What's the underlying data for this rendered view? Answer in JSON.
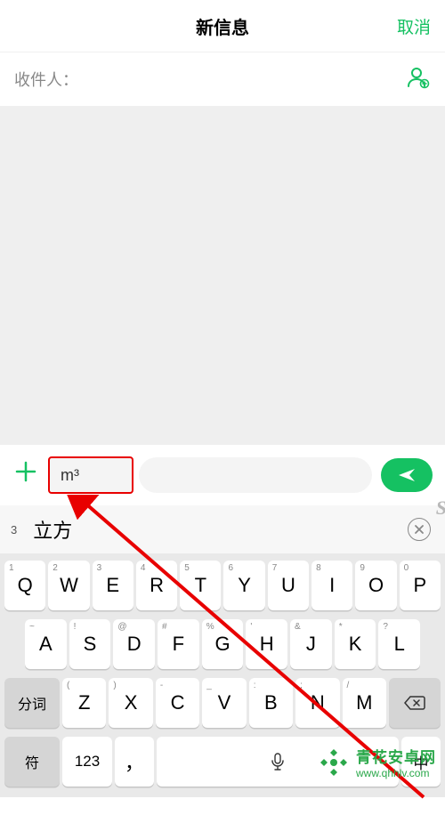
{
  "header": {
    "title": "新信息",
    "cancel": "取消"
  },
  "recipient": {
    "label": "收件人："
  },
  "input": {
    "value": "m³"
  },
  "candidates": {
    "small": "3",
    "main": "立方",
    "s_hint": "S"
  },
  "keyboard": {
    "row1": [
      {
        "m": "Q",
        "s": "1"
      },
      {
        "m": "W",
        "s": "2"
      },
      {
        "m": "E",
        "s": "3"
      },
      {
        "m": "R",
        "s": "4"
      },
      {
        "m": "T",
        "s": "5"
      },
      {
        "m": "Y",
        "s": "6"
      },
      {
        "m": "U",
        "s": "7"
      },
      {
        "m": "I",
        "s": "8"
      },
      {
        "m": "O",
        "s": "9"
      },
      {
        "m": "P",
        "s": "0"
      }
    ],
    "row2": [
      {
        "m": "A",
        "s": "~"
      },
      {
        "m": "S",
        "s": "!"
      },
      {
        "m": "D",
        "s": "@"
      },
      {
        "m": "F",
        "s": "#"
      },
      {
        "m": "G",
        "s": "%"
      },
      {
        "m": "H",
        "s": "'"
      },
      {
        "m": "J",
        "s": "&"
      },
      {
        "m": "K",
        "s": "*"
      },
      {
        "m": "L",
        "s": "?"
      }
    ],
    "row3": {
      "segci": "分词",
      "keys": [
        {
          "m": "Z",
          "s": "("
        },
        {
          "m": "X",
          "s": ")"
        },
        {
          "m": "C",
          "s": "-"
        },
        {
          "m": "V",
          "s": "_"
        },
        {
          "m": "B",
          "s": ":"
        },
        {
          "m": "N",
          "s": ";"
        },
        {
          "m": "M",
          "s": "/"
        }
      ]
    },
    "row4": {
      "sym": "符",
      "num": "123",
      "comma": "，",
      "cn": "中"
    }
  },
  "watermark": {
    "line1": "青花安卓网",
    "line2": "www.qhhlv.com"
  },
  "colors": {
    "accent": "#15c162",
    "highlight": "#e80000"
  }
}
